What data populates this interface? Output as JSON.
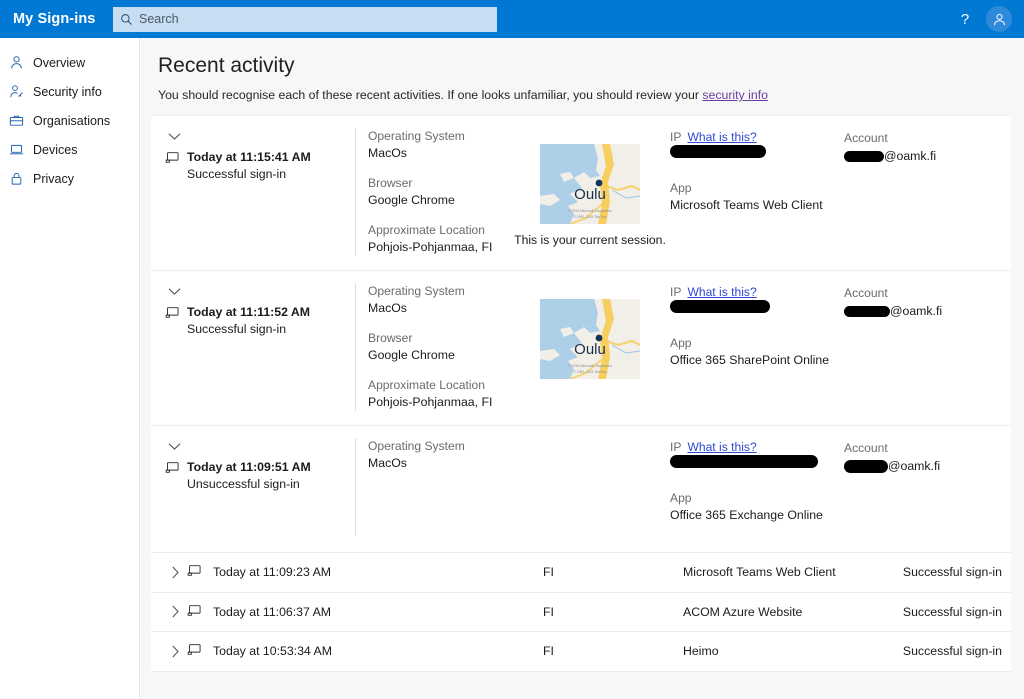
{
  "topbar": {
    "brand": "My Sign-ins",
    "search_placeholder": "Search",
    "search_value": "",
    "help_glyph": "?",
    "search_icon_name": "search-icon",
    "accent_color": "#0078d4"
  },
  "sidebar": {
    "items": [
      {
        "label": "Overview",
        "icon": "person-icon"
      },
      {
        "label": "Security info",
        "icon": "person-key-icon"
      },
      {
        "label": "Organisations",
        "icon": "briefcase-icon"
      },
      {
        "label": "Devices",
        "icon": "laptop-icon"
      },
      {
        "label": "Privacy",
        "icon": "lock-icon"
      }
    ]
  },
  "main": {
    "title": "Recent activity",
    "subtitle_before": "You should recognise each of these recent activities. If one looks unfamiliar, you should review your ",
    "subtitle_link": "security info"
  },
  "labels": {
    "operating_system": "Operating System",
    "browser": "Browser",
    "approximate_location": "Approximate Location",
    "ip": "IP",
    "what_is_this": "What is this?",
    "app": "App",
    "account": "Account"
  },
  "activities": [
    {
      "when": "Today at 11:15:41 AM",
      "status": "Successful sign-in",
      "operating_system": "MacOs",
      "browser": "Google Chrome",
      "location": "Pohjois-Pohjanmaa, FI",
      "map_label": "Oulu",
      "map_attribution": "© 2019 Microsoft Corporation  © 1992–2019 TomTom",
      "map_caption": "This is your current session.",
      "ip_value": "",
      "app": "Microsoft Teams Web Client",
      "account_suffix": "@oamk.fi",
      "expanded": true
    },
    {
      "when": "Today at 11:11:52 AM",
      "status": "Successful sign-in",
      "operating_system": "MacOs",
      "browser": "Google Chrome",
      "location": "Pohjois-Pohjanmaa, FI",
      "map_label": "Oulu",
      "map_attribution": "© 2019 Microsoft Corporation  © 1992–2019 TomTom",
      "map_caption": "",
      "ip_value": "",
      "app": "Office 365 SharePoint Online",
      "account_suffix": "@oamk.fi",
      "expanded": true
    },
    {
      "when": "Today at 11:09:51 AM",
      "status": "Unsuccessful sign-in",
      "operating_system": "MacOs",
      "browser": "",
      "location": "",
      "map_label": "",
      "map_attribution": "",
      "map_caption": "",
      "ip_value": "",
      "app": "Office 365 Exchange Online",
      "account_suffix": "@oamk.fi",
      "expanded": true
    }
  ],
  "collapsed_rows": [
    {
      "when": "Today at 11:09:23 AM",
      "location": "FI",
      "app": "Microsoft Teams Web Client",
      "status": "Successful sign-in"
    },
    {
      "when": "Today at 11:06:37 AM",
      "location": "FI",
      "app": "ACOM Azure Website",
      "status": "Successful sign-in"
    },
    {
      "when": "Today at 10:53:34 AM",
      "location": "FI",
      "app": "Heimo",
      "status": "Successful sign-in"
    }
  ]
}
